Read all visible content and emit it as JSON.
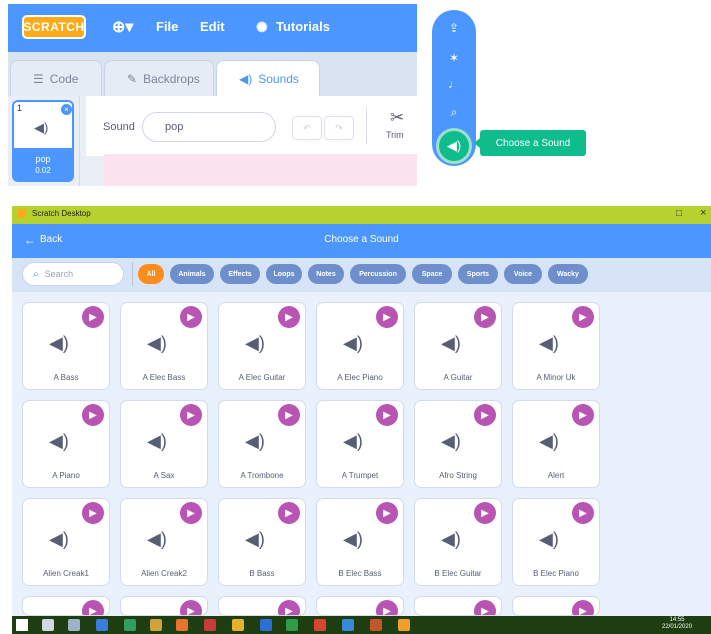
{
  "editor": {
    "logo": "SCRATCH",
    "menu": {
      "file": "File",
      "edit": "Edit",
      "tutorials": "Tutorials"
    },
    "tabs": {
      "code": "Code",
      "backdrops": "Backdrops",
      "sounds": "Sounds"
    },
    "sprite": {
      "index": "1",
      "name": "pop",
      "duration": "0.02"
    },
    "sound_label": "Sound",
    "sound_value": "pop",
    "trim_label": "Trim"
  },
  "palette": {
    "tooltip": "Choose a Sound"
  },
  "library": {
    "window_title": "Scratch Desktop",
    "back_label": "Back",
    "header_title": "Choose a Sound",
    "search_placeholder": "Search",
    "filters": [
      "All",
      "Animals",
      "Effects",
      "Loops",
      "Notes",
      "Percussion",
      "Space",
      "Sports",
      "Voice",
      "Wacky"
    ],
    "active_filter": "All",
    "sounds": [
      "A Bass",
      "A Elec Bass",
      "A Elec Guitar",
      "A Elec Piano",
      "A Guitar",
      "A Minor Uk",
      "A Piano",
      "A Sax",
      "A Trombone",
      "A Trumpet",
      "Afro String",
      "Alert",
      "Alien Creak1",
      "Alien Creak2",
      "B Bass",
      "B Elec Bass",
      "B Elec Guitar",
      "B Elec Piano"
    ]
  },
  "taskbar": {
    "time": "14:55",
    "date": "22/01/2020"
  },
  "colors": {
    "scratch_blue": "#4c97ff",
    "orange": "#ff8c1a",
    "green": "#0fbd8c",
    "purple": "#b854b1",
    "titlebar": "#b7d12e"
  },
  "icons": [
    "globe-icon",
    "lightbulb-icon",
    "code-icon",
    "brush-icon",
    "speaker-icon",
    "scissors-icon",
    "upload-icon",
    "sparkle-icon",
    "microphone-icon",
    "search-icon",
    "back-arrow-icon",
    "play-icon"
  ]
}
